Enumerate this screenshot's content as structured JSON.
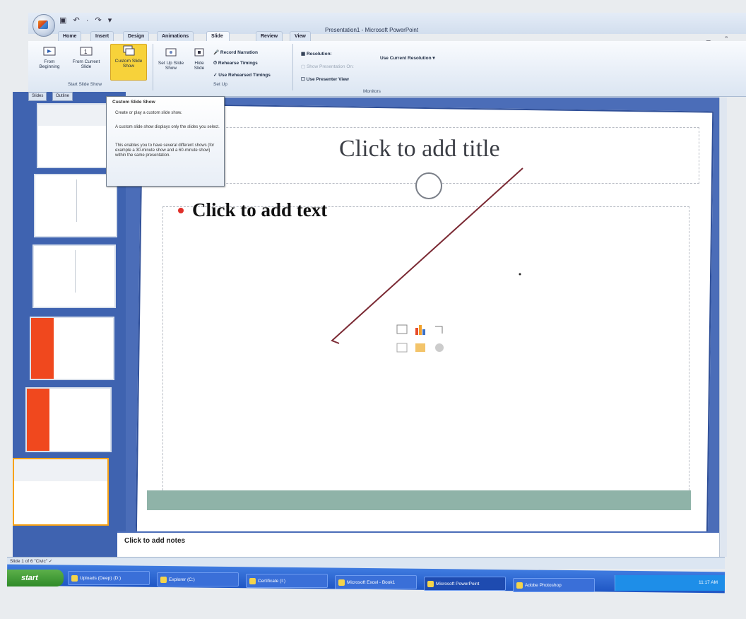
{
  "window": {
    "title": "Presentation1 - Microsoft PowerPoint",
    "controls": "_ ▫ ×",
    "qat": "▣ ↶ · ↷ ▾"
  },
  "tabs": [
    {
      "label": "Home"
    },
    {
      "label": "Insert"
    },
    {
      "label": "Design"
    },
    {
      "label": "Animations"
    },
    {
      "label": "Slide Show"
    },
    {
      "label": "Review"
    },
    {
      "label": "View"
    }
  ],
  "ribbon": {
    "start_group": {
      "label": "Start Slide Show",
      "from_beginning": "From Beginning",
      "from_current": "From Current Slide",
      "custom": "Custom Slide Show"
    },
    "setup_group": {
      "label": "Set Up",
      "setup_show": "Set Up Slide Show",
      "hide_slide": "Hide Slide",
      "record_narration": "Record Narration",
      "rehearse_timings": "Rehearse Timings",
      "use_rehearsed": "Use Rehearsed Timings"
    },
    "monitors_group": {
      "label": "Monitors",
      "resolution": "Resolution:",
      "resolution_value": "Use Current Resolution",
      "show_on": "Show Presentation On:",
      "presenter_view": "Use Presenter View"
    }
  },
  "tooltip": {
    "title": "Custom Slide Show",
    "line1": "Create or play a custom slide show.",
    "line2": "A custom slide show displays only the slides you select.",
    "line3": "This enables you to have several different shows (for example a 30-minute show and a 60-minute show) within the same presentation."
  },
  "left_pane": {
    "tab_slides": "Slides",
    "tab_outline": "Outline"
  },
  "slide": {
    "title_placeholder": "Click to add title",
    "body_placeholder": "Click to add text"
  },
  "notes": {
    "placeholder": "Click to add notes"
  },
  "status": {
    "text": "Slide 1 of 6    \"Civic\"    ✓"
  },
  "taskbar": {
    "start": "start",
    "items": [
      {
        "label": "Uploads (Deep) (D:)"
      },
      {
        "label": "Explorer (C:)"
      },
      {
        "label": "Certificate (I:)"
      },
      {
        "label": "Microsoft Excel - Book1"
      },
      {
        "label": "Microsoft PowerPoint"
      },
      {
        "label": "Adobe Photoshop"
      }
    ],
    "clock": "11:17 AM"
  },
  "colors": {
    "accent_blue": "#3f63b0",
    "custom_button": "#f7d23a",
    "thumb_red": "#f0481e"
  }
}
